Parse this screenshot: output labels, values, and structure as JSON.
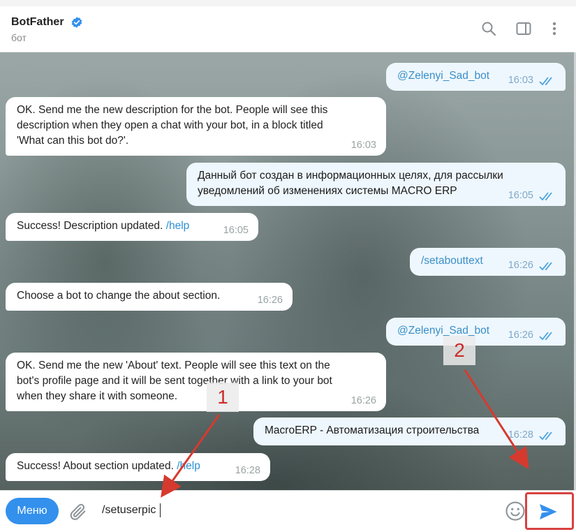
{
  "header": {
    "title": "BotFather",
    "subtitle": "бот",
    "icons": [
      "search-icon",
      "sidebar-toggle-icon",
      "more-vertical-icon",
      "verified-badge-icon"
    ]
  },
  "messages": [
    {
      "dir": "out",
      "text": "@Zelenyi_Sad_bot",
      "time": "16:03",
      "link": true
    },
    {
      "dir": "in",
      "text": "OK. Send me the new description for the bot. People will see this\ndescription when they open a chat with your bot, in a block titled\n'What can this bot do?'.",
      "time": "16:03"
    },
    {
      "dir": "out",
      "text": "Данный бот создан в информационных целях, для рассылки\nуведомлений об изменениях системы MACRO ERP",
      "time": "16:05"
    },
    {
      "dir": "in",
      "text": "Success! Description updated.",
      "link_text": "/help",
      "time": "16:05"
    },
    {
      "dir": "out",
      "text": "/setabouttext",
      "time": "16:26",
      "link": true
    },
    {
      "dir": "in",
      "text": "Choose a bot to change the about section.",
      "time": "16:26"
    },
    {
      "dir": "out",
      "text": "@Zelenyi_Sad_bot",
      "time": "16:26",
      "link": true
    },
    {
      "dir": "in",
      "text": "OK. Send me the new 'About' text. People will see this text on the\nbot's profile page and it will be sent together with a link to your bot\nwhen they share it with someone.",
      "time": "16:26"
    },
    {
      "dir": "out",
      "text": "MacroERP - Автоматизация строительства",
      "time": "16:28"
    },
    {
      "dir": "in",
      "text": "Success! About section updated.",
      "link_text": "/help",
      "time": "16:28"
    }
  ],
  "annotations": {
    "label_1": "1",
    "label_2": "2",
    "arrow_color": "#d63a2f"
  },
  "composer": {
    "menu_label": "Меню",
    "input_value": "/setuserpic",
    "icons": [
      "attach-icon",
      "emoji-icon",
      "send-icon"
    ]
  },
  "colors": {
    "accent": "#3390ec",
    "link": "#2a8fd4",
    "outgoing_bg": "#eef7fd",
    "highlight_border": "#d94141"
  }
}
